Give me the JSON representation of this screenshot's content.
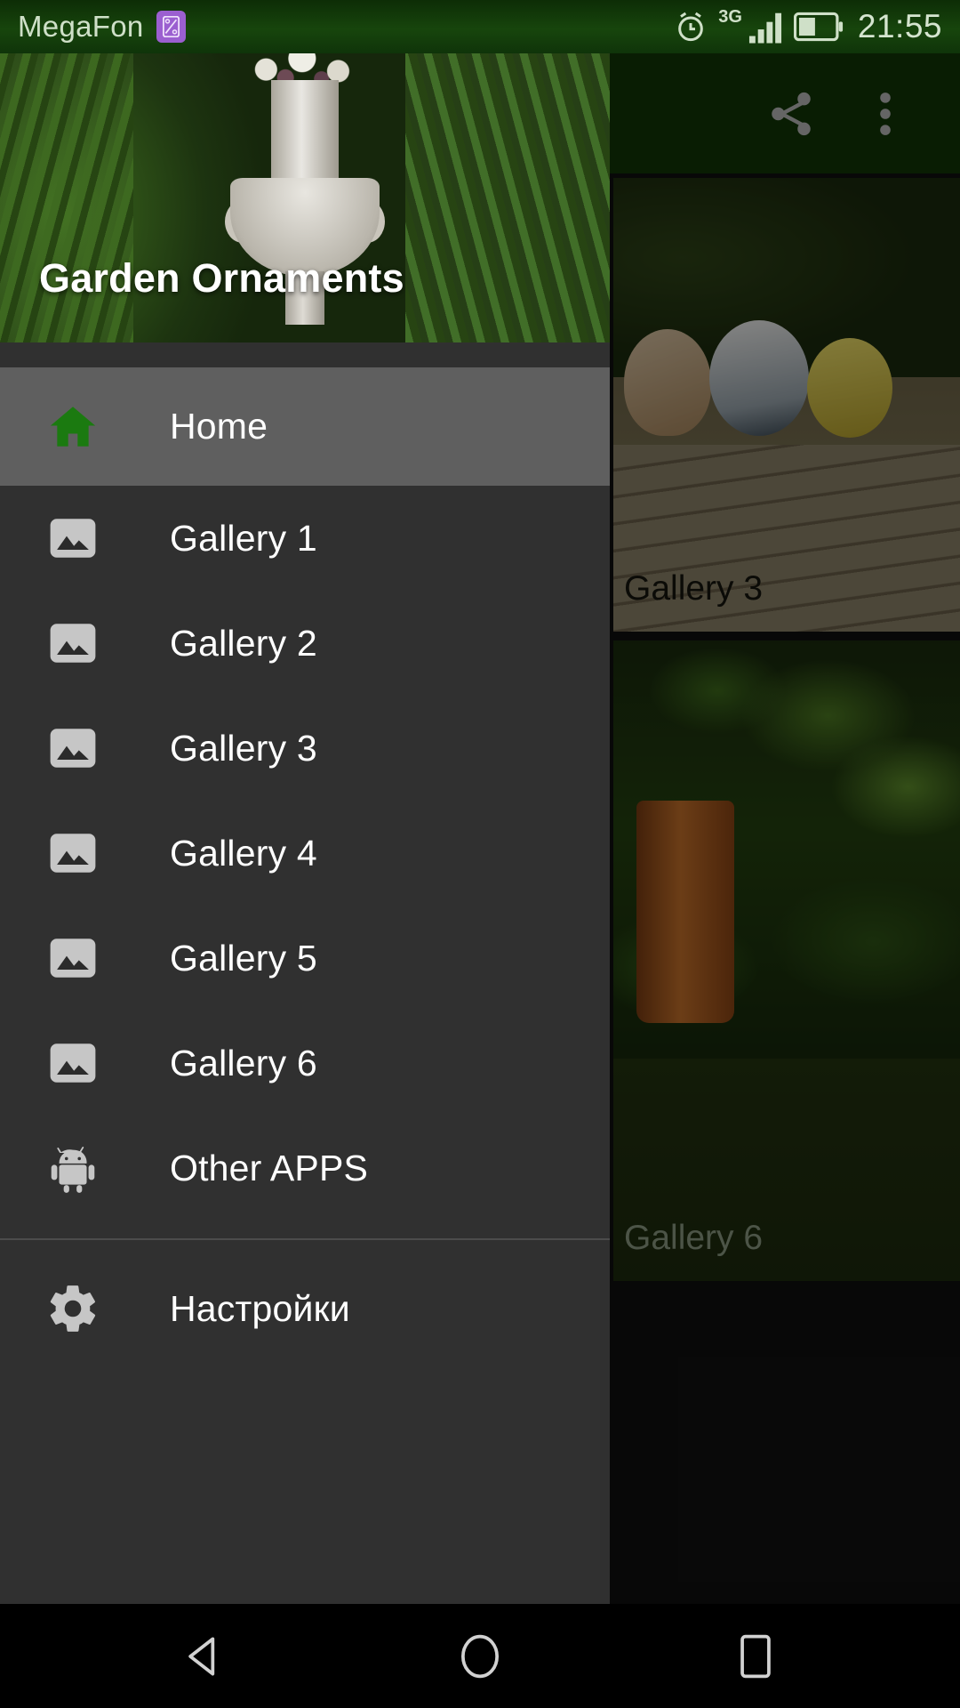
{
  "status_bar": {
    "carrier": "MegaFon",
    "sim_icon": "sim-card-icon",
    "alarm_icon": "alarm-clock-icon",
    "network_type": "3G",
    "signal_icon": "signal-bars-icon",
    "battery_icon": "battery-half-icon",
    "clock": "21:55"
  },
  "action_bar": {
    "share_icon": "share-icon",
    "overflow_icon": "overflow-menu-icon"
  },
  "drawer": {
    "title": "Garden Ornaments",
    "header_image": "garden-urn-photo",
    "items": [
      {
        "label": "Home",
        "icon": "home-icon",
        "selected": true
      },
      {
        "label": "Gallery 1",
        "icon": "image-icon",
        "selected": false
      },
      {
        "label": "Gallery 2",
        "icon": "image-icon",
        "selected": false
      },
      {
        "label": "Gallery 3",
        "icon": "image-icon",
        "selected": false
      },
      {
        "label": "Gallery 4",
        "icon": "image-icon",
        "selected": false
      },
      {
        "label": "Gallery 5",
        "icon": "image-icon",
        "selected": false
      },
      {
        "label": "Gallery 6",
        "icon": "image-icon",
        "selected": false
      },
      {
        "label": "Other APPS",
        "icon": "android-robot-icon",
        "selected": false
      }
    ],
    "footer_items": [
      {
        "label": "Настройки",
        "icon": "gear-icon"
      }
    ]
  },
  "content_cards": [
    {
      "label": "Gallery 3",
      "image": "garden-birds-photo"
    },
    {
      "label": "",
      "image": "potted-hosta-photo"
    },
    {
      "label": "Gallery 6",
      "image": "garden-plant-photo"
    }
  ],
  "system_nav": {
    "back": "back-triangle-icon",
    "home": "home-circle-icon",
    "recents": "recents-square-icon"
  },
  "colors": {
    "status_bar_green": "#17450c",
    "action_bar_green": "#123507",
    "drawer_bg": "#303030",
    "drawer_selected": "#5f5f5f",
    "home_icon_green": "#1b7a10",
    "icon_gray": "#c6c6c6",
    "text_white": "#ffffff"
  }
}
